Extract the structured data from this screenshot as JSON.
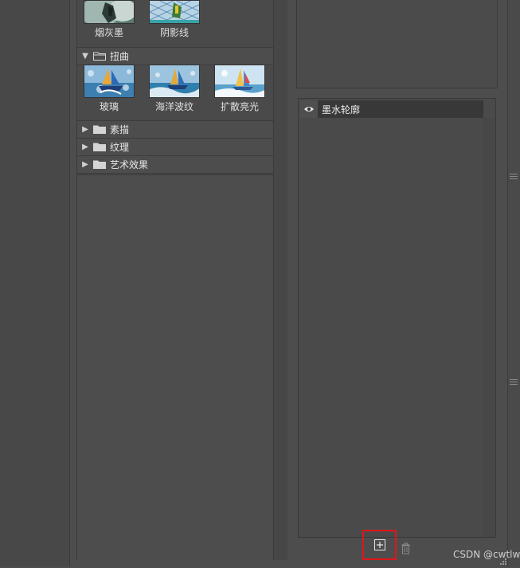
{
  "gallery": {
    "top_thumbs": [
      {
        "label": "烟灰墨"
      },
      {
        "label": "阴影线"
      }
    ],
    "distort_category": {
      "label": "扭曲",
      "expanded": true
    },
    "distort_thumbs": [
      {
        "label": "玻璃"
      },
      {
        "label": "海洋波纹"
      },
      {
        "label": "扩散亮光"
      }
    ],
    "categories": [
      {
        "label": "素描"
      },
      {
        "label": "纹理"
      },
      {
        "label": "艺术效果"
      }
    ]
  },
  "layers": {
    "items": [
      {
        "name": "墨水轮廓",
        "visible": true
      }
    ]
  },
  "toolbar": {
    "new_icon": "new-layer-icon",
    "delete_icon": "trash-icon",
    "highlight_color": "#e0161a"
  },
  "watermark": "CSDN @cwtlw",
  "colors": {
    "bg": "#4d4d4d",
    "selected_layer": "#383838"
  }
}
